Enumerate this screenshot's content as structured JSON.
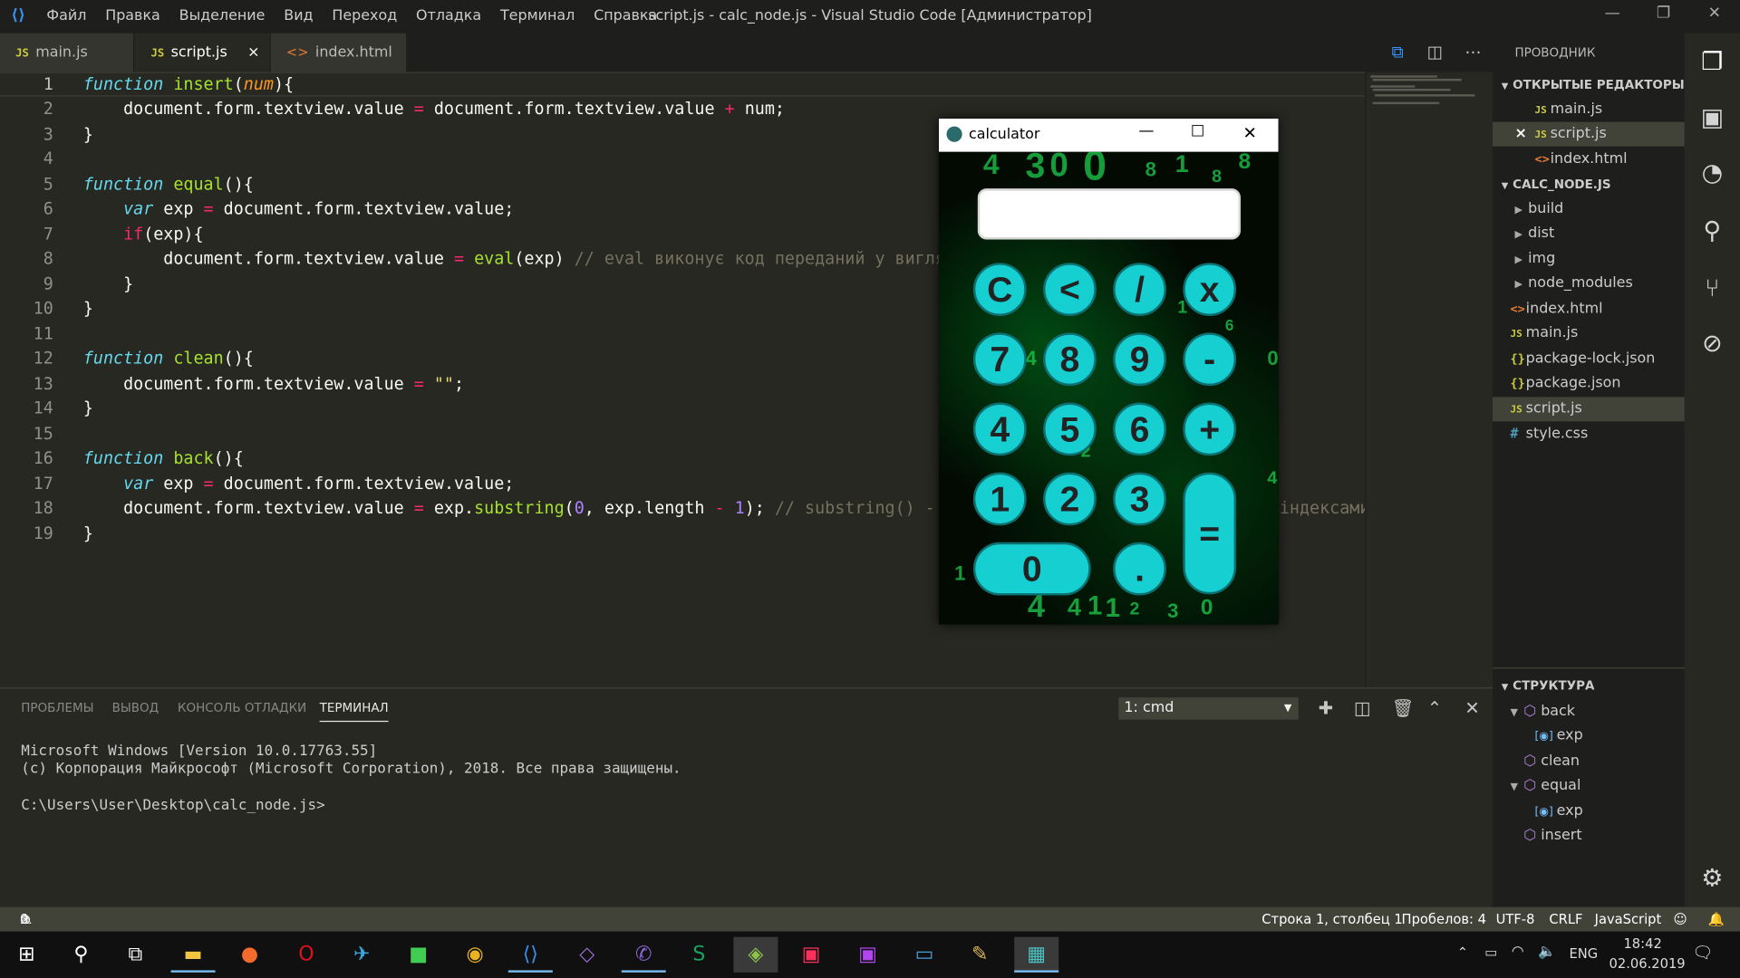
{
  "titlebar": {
    "menu": [
      "Файл",
      "Правка",
      "Выделение",
      "Вид",
      "Переход",
      "Отладка",
      "Терминал",
      "Справка"
    ],
    "title": "script.js - calc_node.js - Visual Studio Code [Администратор]"
  },
  "tabs": [
    {
      "label": "main.js",
      "icon": "JS"
    },
    {
      "label": "script.js",
      "icon": "JS",
      "close": "×"
    },
    {
      "label": "index.html",
      "icon": "<>"
    }
  ],
  "code_lines": [
    "1",
    "2",
    "3",
    "4",
    "5",
    "6",
    "7",
    "8",
    "9",
    "10",
    "11",
    "12",
    "13",
    "14",
    "15",
    "16",
    "17",
    "18",
    "19"
  ],
  "code": {
    "l1": [
      "function",
      " ",
      "insert",
      "(",
      "num",
      "){"
    ],
    "l2": [
      "    document.form.textview.value ",
      "=",
      " document.form.textview.value ",
      "+",
      " num;"
    ],
    "l3": "}",
    "l5": [
      "function",
      " ",
      "equal",
      "(){"
    ],
    "l6": [
      "    ",
      "var",
      " exp ",
      "=",
      " document.form.textview.value;"
    ],
    "l7": [
      "    ",
      "if",
      "(exp){"
    ],
    "l8": [
      "        document.form.textview.value ",
      "=",
      " ",
      "eval",
      "(exp) ",
      "// eval виконує код переданий у вигля"
    ],
    "l9": "    }",
    "l10": "}",
    "l12": [
      "function",
      " ",
      "clean",
      "(){"
    ],
    "l13": [
      "    document.form.textview.value ",
      "=",
      " ",
      "\"\"",
      ";"
    ],
    "l14": "}",
    "l16": [
      "function",
      " ",
      "back",
      "(){"
    ],
    "l17": [
      "    ",
      "var",
      " exp ",
      "=",
      " document.form.textview.value;"
    ],
    "l18": [
      "    document.form.textview.value ",
      "=",
      " exp.",
      "substring",
      "(",
      "0",
      ", exp.length ",
      "-",
      " ",
      "1",
      "); ",
      "// substring() -"
    ],
    "l18_tail": "індексами",
    "l19": "}"
  },
  "explorer": {
    "header": "ПРОВОДНИК",
    "open_editors_label": "ОТКРЫТЫЕ РЕДАКТОРЫ",
    "open_editors": [
      {
        "name": "main.js",
        "icon": "JS"
      },
      {
        "name": "script.js",
        "icon": "JS",
        "close": "×"
      },
      {
        "name": "index.html",
        "icon": "<>"
      }
    ],
    "folder_label": "CALC_NODE.JS",
    "folders": [
      "build",
      "dist",
      "img",
      "node_modules"
    ],
    "files": [
      {
        "name": "index.html",
        "icon": "<>"
      },
      {
        "name": "main.js",
        "icon": "JS"
      },
      {
        "name": "package-lock.json",
        "icon": "{}"
      },
      {
        "name": "package.json",
        "icon": "{}"
      },
      {
        "name": "script.js",
        "icon": "JS"
      },
      {
        "name": "style.css",
        "icon": "#"
      }
    ],
    "outline_label": "СТРУКТУРА",
    "outline": [
      "back",
      "exp",
      "clean",
      "equal",
      "exp",
      "insert"
    ]
  },
  "panel": {
    "tabs": [
      "ПРОБЛЕМЫ",
      "ВЫВОД",
      "КОНСОЛЬ ОТЛАДКИ",
      "ТЕРМИНАЛ"
    ],
    "terminal_select": "1: cmd",
    "lines": [
      "Microsoft Windows [Version 10.0.17763.55]",
      "(c) Корпорация Майкрософт (Microsoft Corporation), 2018. Все права защищены.",
      "C:\\Users\\User\\Desktop\\calc_node.js>"
    ]
  },
  "status": {
    "errors": "0",
    "warnings": "0",
    "position": "Строка 1, столбец 1",
    "spaces": "Пробелов: 4",
    "encoding": "UTF-8",
    "eol": "CRLF",
    "language": "JavaScript"
  },
  "calculator": {
    "title": "calculator",
    "display_value": "",
    "buttons": [
      "C",
      "<",
      "/",
      "x",
      "7",
      "8",
      "9",
      "-",
      "4",
      "5",
      "6",
      "+",
      "1",
      "2",
      "3",
      "=",
      "0",
      "."
    ],
    "background_glyphs": [
      "4",
      "3",
      "0",
      "0",
      "8",
      "1",
      "8",
      "8",
      "2",
      "9",
      "1",
      "6",
      "6",
      "4",
      "0",
      "7",
      "2",
      "4",
      "4",
      "3",
      "1",
      "6",
      "4",
      "4",
      "1",
      "1",
      "2",
      "3",
      "0"
    ]
  },
  "taskbar": {
    "lang": "ENG",
    "time": "18:42",
    "date": "02.06.2019"
  },
  "colors": {
    "editor_bg": "#272822",
    "keyword": "#66d9ef",
    "function": "#a6e22e",
    "operator": "#f92672",
    "calc_button": "#16cfd0"
  }
}
